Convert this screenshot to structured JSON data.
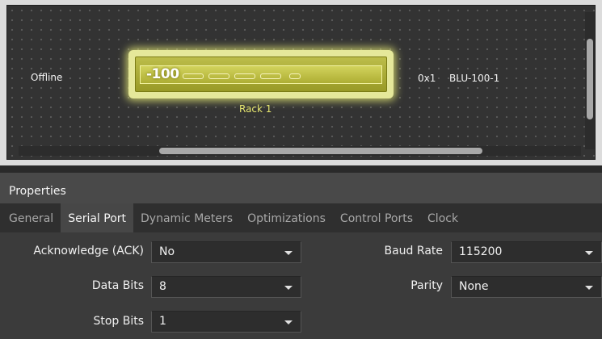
{
  "canvas": {
    "status": "Offline",
    "device": {
      "logo": "-100",
      "address": "0x1",
      "name": "BLU-100-1",
      "rack": "Rack 1"
    }
  },
  "properties": {
    "title": "Properties",
    "tabs": [
      {
        "label": "General",
        "active": false
      },
      {
        "label": "Serial Port",
        "active": true
      },
      {
        "label": "Dynamic Meters",
        "active": false
      },
      {
        "label": "Optimizations",
        "active": false
      },
      {
        "label": "Control Ports",
        "active": false
      },
      {
        "label": "Clock",
        "active": false
      }
    ],
    "fields": {
      "ack": {
        "label": "Acknowledge (ACK)",
        "value": "No"
      },
      "data_bits": {
        "label": "Data Bits",
        "value": "8"
      },
      "stop_bits": {
        "label": "Stop Bits",
        "value": "1"
      },
      "baud_rate": {
        "label": "Baud Rate",
        "value": "115200"
      },
      "parity": {
        "label": "Parity",
        "value": "None"
      }
    }
  },
  "colors": {
    "device_highlight": "#e5e89a",
    "panel_bg": "#3b3b3b",
    "canvas_bg": "#333333"
  }
}
